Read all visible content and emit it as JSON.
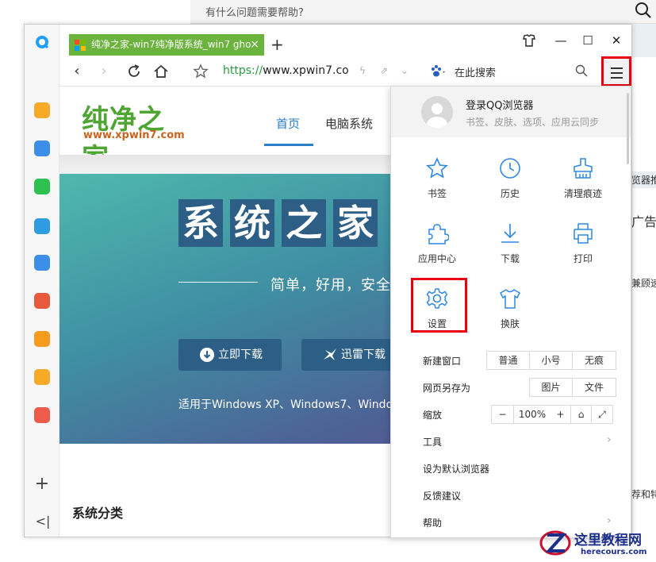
{
  "background": {
    "search_placeholder": "有什么问题需要帮助?",
    "right_fragments": [
      "览器推",
      "广告",
      "兼顾速",
      "荐和特"
    ]
  },
  "browser": {
    "tab": {
      "title": "纯净之家-win7纯净版系统_win7 gho",
      "close": "×"
    },
    "new_tab": "+",
    "window_controls": {
      "skin": "skin-icon",
      "minimize": "—",
      "maximize": "☐",
      "close": "✕"
    },
    "nav": {
      "url_scheme": "https://",
      "url_host": "www.xpwin7.co",
      "search_label": "在此搜索"
    },
    "sidebar": {
      "add": "+",
      "collapse": "<|"
    }
  },
  "website": {
    "logo_text": "纯净之家",
    "logo_url": "www.xpwin7.com",
    "nav": [
      "首页",
      "电脑系统"
    ],
    "hero": {
      "title_chars": [
        "系",
        "统",
        "之",
        "家"
      ],
      "subtitle": "简单，好用，安全",
      "buttons": [
        "立即下载",
        "迅雷下载"
      ],
      "footer": "适用于Windows XP、Windows7、Windo"
    },
    "section_title": "系统分类"
  },
  "menu": {
    "login_title": "登录QQ浏览器",
    "login_subtitle": "书签、皮肤、选项、应用云同步",
    "grid": [
      {
        "label": "书签",
        "icon": "star-icon"
      },
      {
        "label": "历史",
        "icon": "clock-icon"
      },
      {
        "label": "清理痕迹",
        "icon": "broom-icon"
      },
      {
        "label": "应用中心",
        "icon": "puzzle-icon"
      },
      {
        "label": "下载",
        "icon": "download-icon"
      },
      {
        "label": "打印",
        "icon": "printer-icon"
      },
      {
        "label": "设置",
        "icon": "gear-icon"
      },
      {
        "label": "换肤",
        "icon": "shirt-icon"
      }
    ],
    "new_window": {
      "label": "新建窗口",
      "options": [
        "普通",
        "小号",
        "无痕"
      ]
    },
    "save_page": {
      "label": "网页另存为",
      "options": [
        "图片",
        "文件"
      ]
    },
    "zoom": {
      "label": "缩放",
      "minus": "−",
      "value": "100%",
      "plus": "+"
    },
    "items": [
      "工具",
      "设为默认浏览器",
      "反馈建议",
      "帮助"
    ]
  },
  "watermark": {
    "title": "这里教程网",
    "url": "herecours.com"
  },
  "colors": {
    "tab_green": "#6ab33c",
    "highlight_red": "#e60012",
    "link_blue": "#2a7dc8",
    "hero_dark": "#2d5f86"
  }
}
